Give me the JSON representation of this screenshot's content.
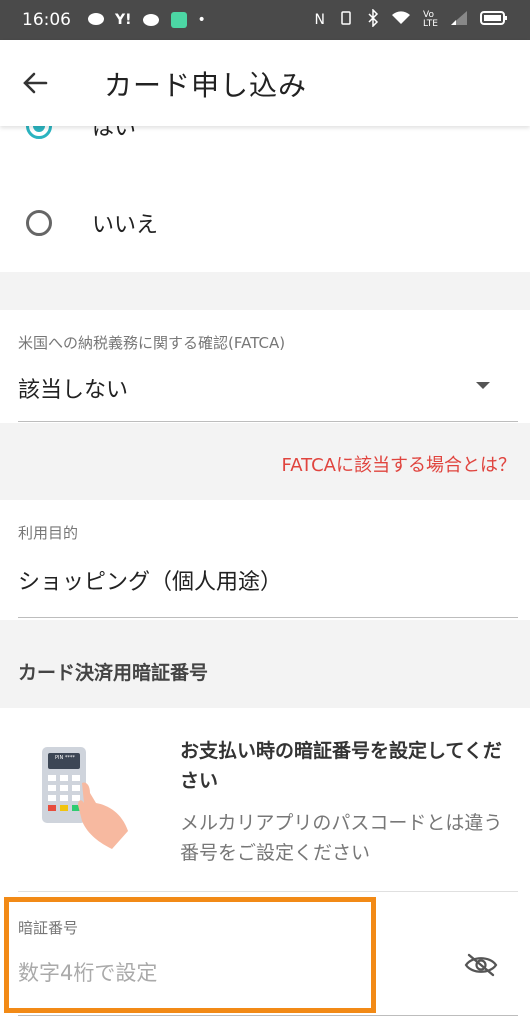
{
  "status_bar": {
    "time": "16:06"
  },
  "app_bar": {
    "title": "カード申し込み"
  },
  "radio_options": [
    {
      "label": "はい",
      "selected": true
    },
    {
      "label": "いいえ",
      "selected": false
    }
  ],
  "fatca": {
    "label": "米国への納税義務に関する確認(FATCA)",
    "value": "該当しない",
    "link": "FATCAに該当する場合とは？"
  },
  "purpose": {
    "label": "利用目的",
    "value": "ショッピング（個人用途）"
  },
  "pin_section": {
    "header": "カード決済用暗証番号",
    "title": "お支払い時の暗証番号を設定してください",
    "description": "メルカリアプリのパスコードとは違う番号をご設定ください",
    "illustration_text": "PIN ****",
    "field_label": "暗証番号",
    "placeholder": "数字4桁で設定"
  },
  "colors": {
    "accent": "#2bb4c0",
    "link": "#e0443e",
    "highlight": "#f28a16"
  }
}
